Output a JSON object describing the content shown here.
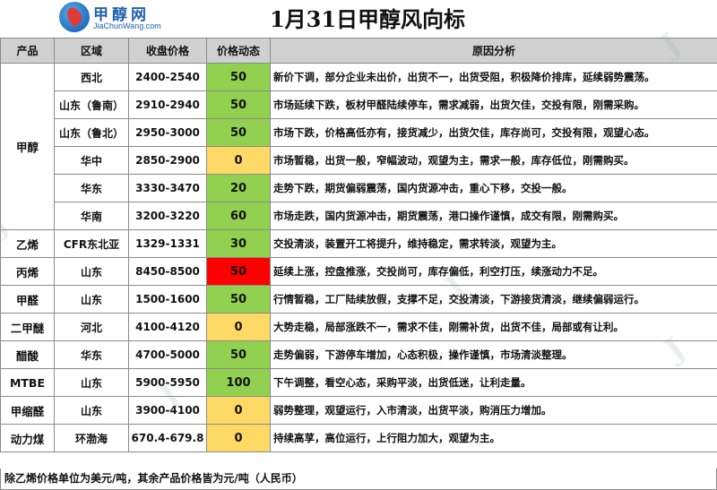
{
  "header": {
    "logo_cn": "甲醇网",
    "logo_en": "JiaChunWang.com",
    "title": "1月31日甲醇风向标"
  },
  "columns": [
    "产品",
    "区域",
    "收盘价格",
    "价格动态",
    "原因分析"
  ],
  "rows": [
    {
      "product": "甲醇",
      "region": "西北",
      "price": "2400-2540",
      "dyn": "50",
      "color": "green",
      "reason": "新价下调，部分企业未出价，出货不一，出货受阻，积极降价排库，延续弱势震荡。"
    },
    {
      "product": "",
      "region": "山东（鲁南）",
      "price": "2910-2940",
      "dyn": "50",
      "color": "green",
      "reason": "市场延续下跌，板材甲醛陆续停车，需求减弱，出货欠佳，交投有限，刚需采购。"
    },
    {
      "product": "",
      "region": "山东（鲁北）",
      "price": "2950-3000",
      "dyn": "50",
      "color": "green",
      "reason": "市场下跌，价格高低亦有，接货减少，出货欠佳，库存尚可，交投有限，观望心态。"
    },
    {
      "product": "",
      "region": "华中",
      "price": "2850-2900",
      "dyn": "0",
      "color": "yellow",
      "reason": "市场暂稳，出货一般，窄幅波动，观望为主，需求一般，库存低位，刚需购买。"
    },
    {
      "product": "",
      "region": "华东",
      "price": "3330-3470",
      "dyn": "20",
      "color": "green",
      "reason": "走势下跌，期货偏弱震荡，国内货源冲击，重心下移，交投一般。"
    },
    {
      "product": "",
      "region": "华南",
      "price": "3200-3220",
      "dyn": "60",
      "color": "green",
      "reason": "市场走跌，国内货源冲击，期货震荡，港口操作谨慎，成交有限，刚需购买。"
    },
    {
      "product": "乙烯",
      "region": "CFR东北亚",
      "price": "1329-1331",
      "dyn": "30",
      "color": "green",
      "reason": "交投清淡，装置开工将提升，维持稳定，需求转淡，观望为主。"
    },
    {
      "product": "丙烯",
      "region": "山东",
      "price": "8450-8500",
      "dyn": "50",
      "color": "red",
      "reason": "延续上涨，控盘推涨，交投尚可，库存偏低，利空打压，续涨动力不足。"
    },
    {
      "product": "甲醛",
      "region": "山东",
      "price": "1500-1600",
      "dyn": "50",
      "color": "green",
      "reason": "行情暂稳，工厂陆续放假，支撑不足，交投清淡，下游接货清淡，继续偏弱运行。"
    },
    {
      "product": "二甲醚",
      "region": "河北",
      "price": "4100-4120",
      "dyn": "0",
      "color": "yellow",
      "reason": "大势走稳，局部涨跌不一，需求不佳，刚需补货，出货不佳，局部或有让利。"
    },
    {
      "product": "醋酸",
      "region": "华东",
      "price": "4700-5000",
      "dyn": "50",
      "color": "green",
      "reason": "走势偏弱，下游停车增加，心态积极，操作谨慎，市场清淡整理。"
    },
    {
      "product": "MTBE",
      "region": "山东",
      "price": "5900-5950",
      "dyn": "100",
      "color": "green",
      "reason": "下午调整，看空心态，采购平淡，出货低迷，让利走量。"
    },
    {
      "product": "甲缩醛",
      "region": "山东",
      "price": "3900-4100",
      "dyn": "0",
      "color": "yellow",
      "reason": "弱势整理，观望运行，入市清淡，出货平淡，购消压力增加。"
    },
    {
      "product": "动力煤",
      "region": "环渤海",
      "price": "670.4-679.8",
      "dyn": "0",
      "color": "yellow",
      "reason": "持续高莩，高位运行，上行阻力加大，观望为主。"
    }
  ],
  "footer": "除乙烯价格单位为美元/吨，其余产品价格皆为元/吨（人民币）",
  "colors": {
    "green": "#92d050",
    "yellow": "#ffd966",
    "red": "#ff0000",
    "header_bg": "#d0d0d0"
  }
}
